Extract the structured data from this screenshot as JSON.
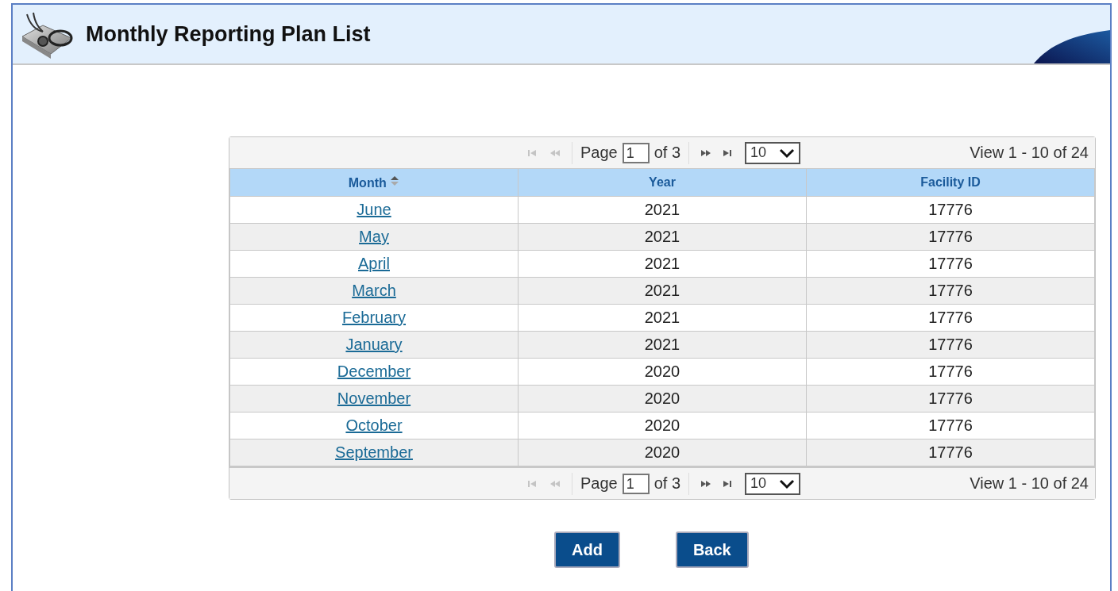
{
  "title": "Monthly Reporting Plan List",
  "pagers": [
    {
      "nav_before": [
        {
          "kind": "first",
          "disabled": true
        },
        {
          "kind": "prev",
          "disabled": true
        }
      ],
      "page_label": "Page",
      "page_value": "1",
      "of_label": "of 3",
      "nav_after": [
        {
          "kind": "next",
          "disabled": false
        },
        {
          "kind": "last",
          "disabled": false
        }
      ],
      "page_size": "10",
      "view_text": "View 1 - 10 of 24"
    },
    {
      "nav_before": [
        {
          "kind": "first",
          "disabled": true
        },
        {
          "kind": "prev",
          "disabled": true
        }
      ],
      "page_label": "Page",
      "page_value": "1",
      "of_label": "of 3",
      "nav_after": [
        {
          "kind": "next",
          "disabled": false
        },
        {
          "kind": "last",
          "disabled": false
        }
      ],
      "page_size": "10",
      "view_text": "View 1 - 10 of 24"
    }
  ],
  "columns": [
    {
      "label": "Month",
      "sorted": true
    },
    {
      "label": "Year",
      "sorted": false
    },
    {
      "label": "Facility ID",
      "sorted": false
    }
  ],
  "rows": [
    {
      "month": "June",
      "year": "2021",
      "facility_id": "17776"
    },
    {
      "month": "May",
      "year": "2021",
      "facility_id": "17776"
    },
    {
      "month": "April",
      "year": "2021",
      "facility_id": "17776"
    },
    {
      "month": "March",
      "year": "2021",
      "facility_id": "17776"
    },
    {
      "month": "February",
      "year": "2021",
      "facility_id": "17776"
    },
    {
      "month": "January",
      "year": "2021",
      "facility_id": "17776"
    },
    {
      "month": "December",
      "year": "2020",
      "facility_id": "17776"
    },
    {
      "month": "November",
      "year": "2020",
      "facility_id": "17776"
    },
    {
      "month": "October",
      "year": "2020",
      "facility_id": "17776"
    },
    {
      "month": "September",
      "year": "2020",
      "facility_id": "17776"
    }
  ],
  "buttons": [
    "Add",
    "Back"
  ]
}
